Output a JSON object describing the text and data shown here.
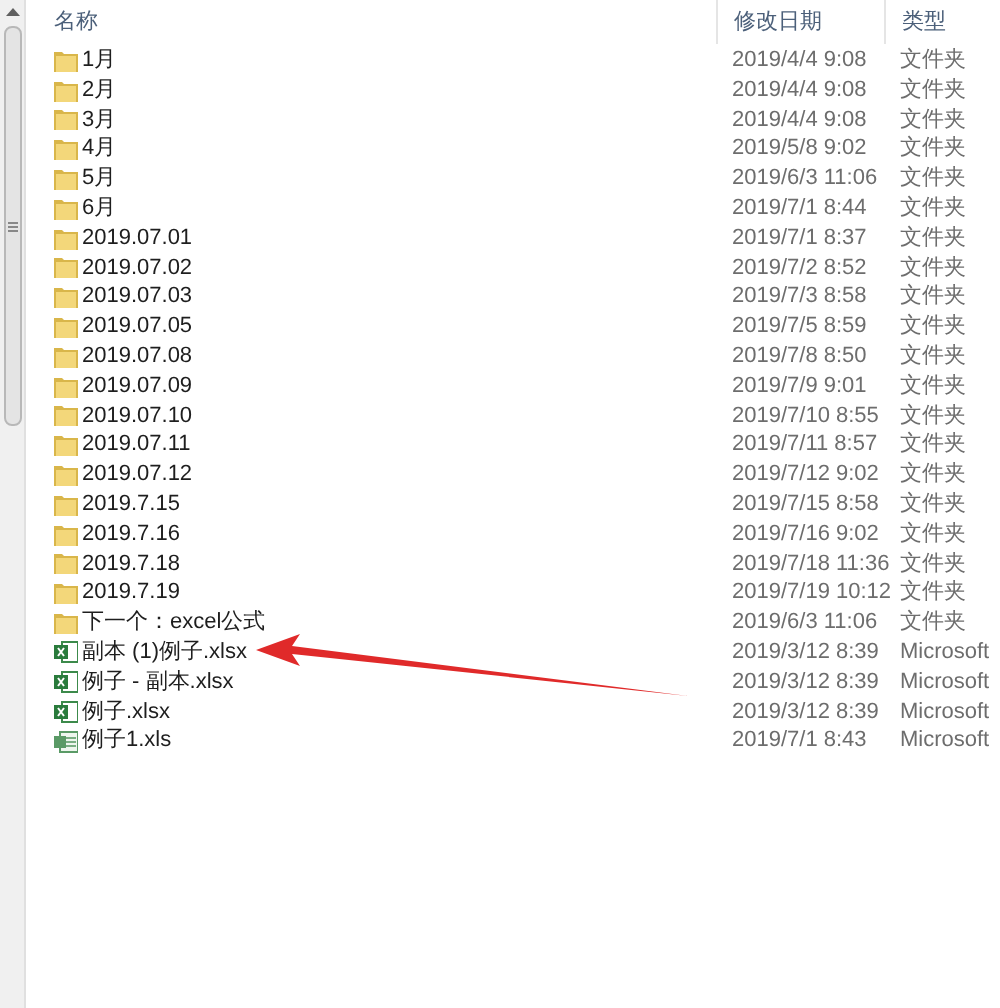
{
  "columns": [
    {
      "label": "名称"
    },
    {
      "label": "修改日期"
    },
    {
      "label": "类型"
    }
  ],
  "rows": [
    {
      "kind": "folder",
      "name": "1月",
      "date": "2019/4/4 9:08",
      "type": "文件夹"
    },
    {
      "kind": "folder",
      "name": "2月",
      "date": "2019/4/4 9:08",
      "type": "文件夹"
    },
    {
      "kind": "folder",
      "name": "3月",
      "date": "2019/4/4 9:08",
      "type": "文件夹"
    },
    {
      "kind": "folder",
      "name": "4月",
      "date": "2019/5/8 9:02",
      "type": "文件夹"
    },
    {
      "kind": "folder",
      "name": "5月",
      "date": "2019/6/3 11:06",
      "type": "文件夹"
    },
    {
      "kind": "folder",
      "name": "6月",
      "date": "2019/7/1 8:44",
      "type": "文件夹"
    },
    {
      "kind": "folder",
      "name": "2019.07.01",
      "date": "2019/7/1 8:37",
      "type": "文件夹"
    },
    {
      "kind": "folder",
      "name": "2019.07.02",
      "date": "2019/7/2 8:52",
      "type": "文件夹"
    },
    {
      "kind": "folder",
      "name": "2019.07.03",
      "date": "2019/7/3 8:58",
      "type": "文件夹"
    },
    {
      "kind": "folder",
      "name": "2019.07.05",
      "date": "2019/7/5 8:59",
      "type": "文件夹"
    },
    {
      "kind": "folder",
      "name": "2019.07.08",
      "date": "2019/7/8 8:50",
      "type": "文件夹"
    },
    {
      "kind": "folder",
      "name": "2019.07.09",
      "date": "2019/7/9 9:01",
      "type": "文件夹"
    },
    {
      "kind": "folder",
      "name": "2019.07.10",
      "date": "2019/7/10 8:55",
      "type": "文件夹"
    },
    {
      "kind": "folder",
      "name": "2019.07.11",
      "date": "2019/7/11 8:57",
      "type": "文件夹"
    },
    {
      "kind": "folder",
      "name": "2019.07.12",
      "date": "2019/7/12 9:02",
      "type": "文件夹"
    },
    {
      "kind": "folder",
      "name": "2019.7.15",
      "date": "2019/7/15 8:58",
      "type": "文件夹"
    },
    {
      "kind": "folder",
      "name": "2019.7.16",
      "date": "2019/7/16 9:02",
      "type": "文件夹"
    },
    {
      "kind": "folder",
      "name": "2019.7.18",
      "date": "2019/7/18 11:36",
      "type": "文件夹"
    },
    {
      "kind": "folder",
      "name": "2019.7.19",
      "date": "2019/7/19 10:12",
      "type": "文件夹"
    },
    {
      "kind": "folder",
      "name": "下一个：excel公式",
      "date": "2019/6/3 11:06",
      "type": "文件夹"
    },
    {
      "kind": "xlsx",
      "name": "副本 (1)例子.xlsx",
      "date": "2019/3/12 8:39",
      "type": "Microsoft"
    },
    {
      "kind": "xlsx",
      "name": "例子 - 副本.xlsx",
      "date": "2019/3/12 8:39",
      "type": "Microsoft"
    },
    {
      "kind": "xlsx",
      "name": "例子.xlsx",
      "date": "2019/3/12 8:39",
      "type": "Microsoft"
    },
    {
      "kind": "xls",
      "name": "例子1.xls",
      "date": "2019/7/1 8:43",
      "type": "Microsoft"
    }
  ]
}
